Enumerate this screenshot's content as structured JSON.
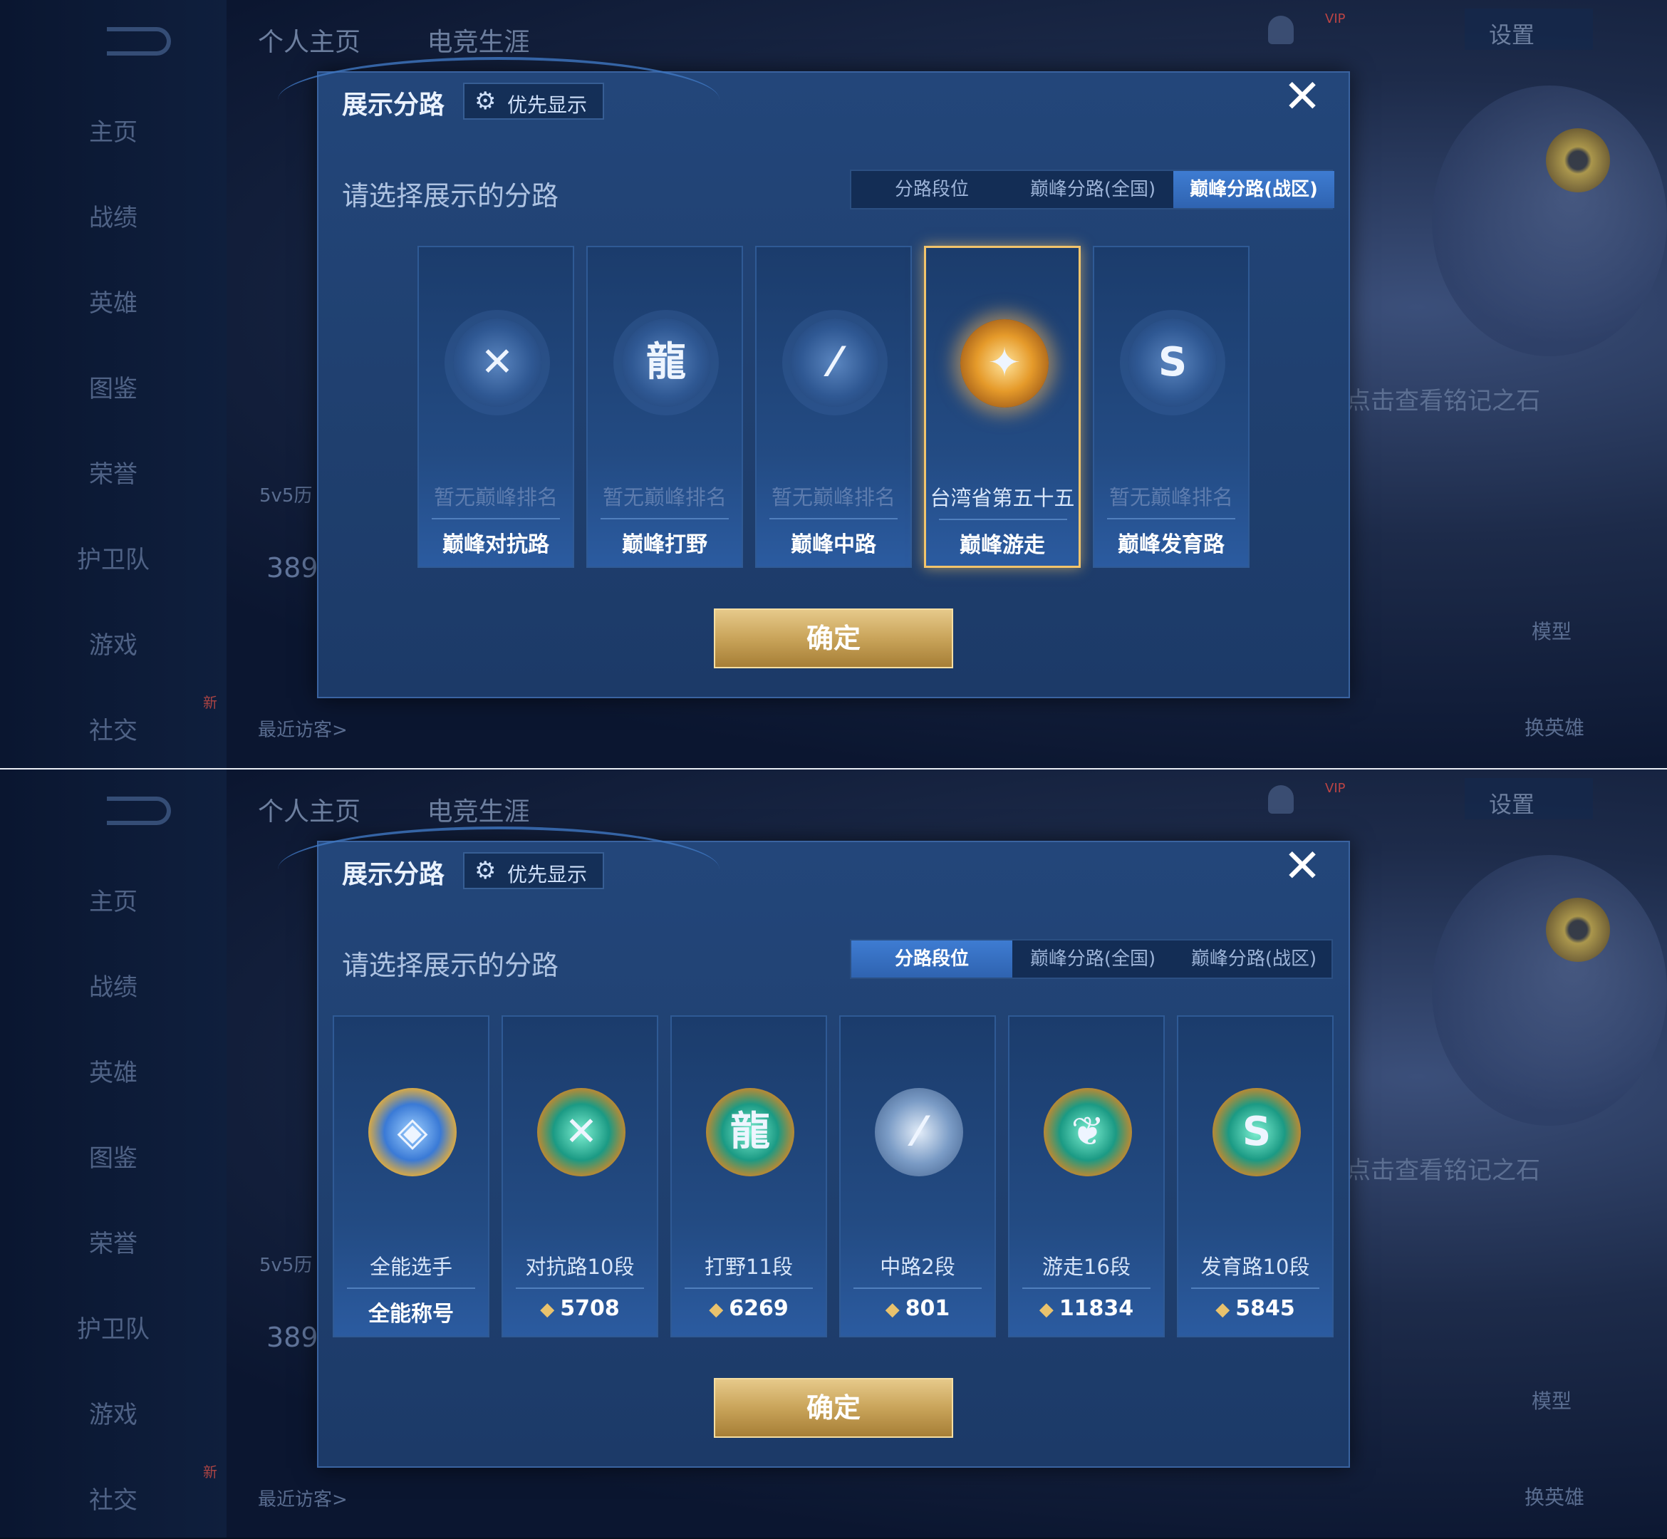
{
  "background": {
    "sidebar": [
      "主页",
      "战绩",
      "英雄",
      "图鉴",
      "荣誉",
      "护卫队",
      "游戏",
      "社交"
    ],
    "top_tabs": [
      "个人主页",
      "电竞生涯"
    ],
    "settings": "设置",
    "stone_hint": "点击查看铭记之石",
    "recent_visitors": "最近访客>",
    "stat_num": "389",
    "mode_5v5": "5v5历",
    "model": "模型",
    "swap_hero": "换英雄",
    "vip": "VIP",
    "new_badge": "新"
  },
  "screen1": {
    "title": "展示分路",
    "priority": "优先显示",
    "subtitle": "请选择展示的分路",
    "tabs": [
      "分路段位",
      "巅峰分路(全国)",
      "巅峰分路(战区)"
    ],
    "active_tab": 2,
    "cards": [
      {
        "rank": "暂无巅峰排名",
        "name": "巅峰对抗路",
        "icon": "clash-lane-icon",
        "glyph": "✕"
      },
      {
        "rank": "暂无巅峰排名",
        "name": "巅峰打野",
        "icon": "jungle-dragon-icon",
        "glyph": "龍"
      },
      {
        "rank": "暂无巅峰排名",
        "name": "巅峰中路",
        "icon": "mid-lane-icon",
        "glyph": "⁄"
      },
      {
        "rank": "台湾省第五十五",
        "name": "巅峰游走",
        "icon": "roam-gold-icon",
        "glyph": "✦"
      },
      {
        "rank": "暂无巅峰排名",
        "name": "巅峰发育路",
        "icon": "farm-lane-icon",
        "glyph": "S"
      }
    ],
    "confirm": "确定"
  },
  "screen2": {
    "title": "展示分路",
    "priority": "优先显示",
    "subtitle": "请选择展示的分路",
    "tabs": [
      "分路段位",
      "巅峰分路(全国)",
      "巅峰分路(战区)"
    ],
    "active_tab": 0,
    "cards": [
      {
        "rank": "全能选手",
        "value": "全能称号",
        "icon": "all-round-icon",
        "glyph": "◈"
      },
      {
        "rank": "对抗路10段",
        "value": "5708",
        "icon": "clash-lane-icon",
        "glyph": "✕"
      },
      {
        "rank": "打野11段",
        "value": "6269",
        "icon": "jungle-dragon-icon",
        "glyph": "龍"
      },
      {
        "rank": "中路2段",
        "value": "801",
        "icon": "mid-lane-icon",
        "glyph": "⁄"
      },
      {
        "rank": "游走16段",
        "value": "11834",
        "icon": "roam-icon",
        "glyph": "❦"
      },
      {
        "rank": "发育路10段",
        "value": "5845",
        "icon": "farm-lane-icon",
        "glyph": "S"
      }
    ],
    "confirm": "确定"
  }
}
